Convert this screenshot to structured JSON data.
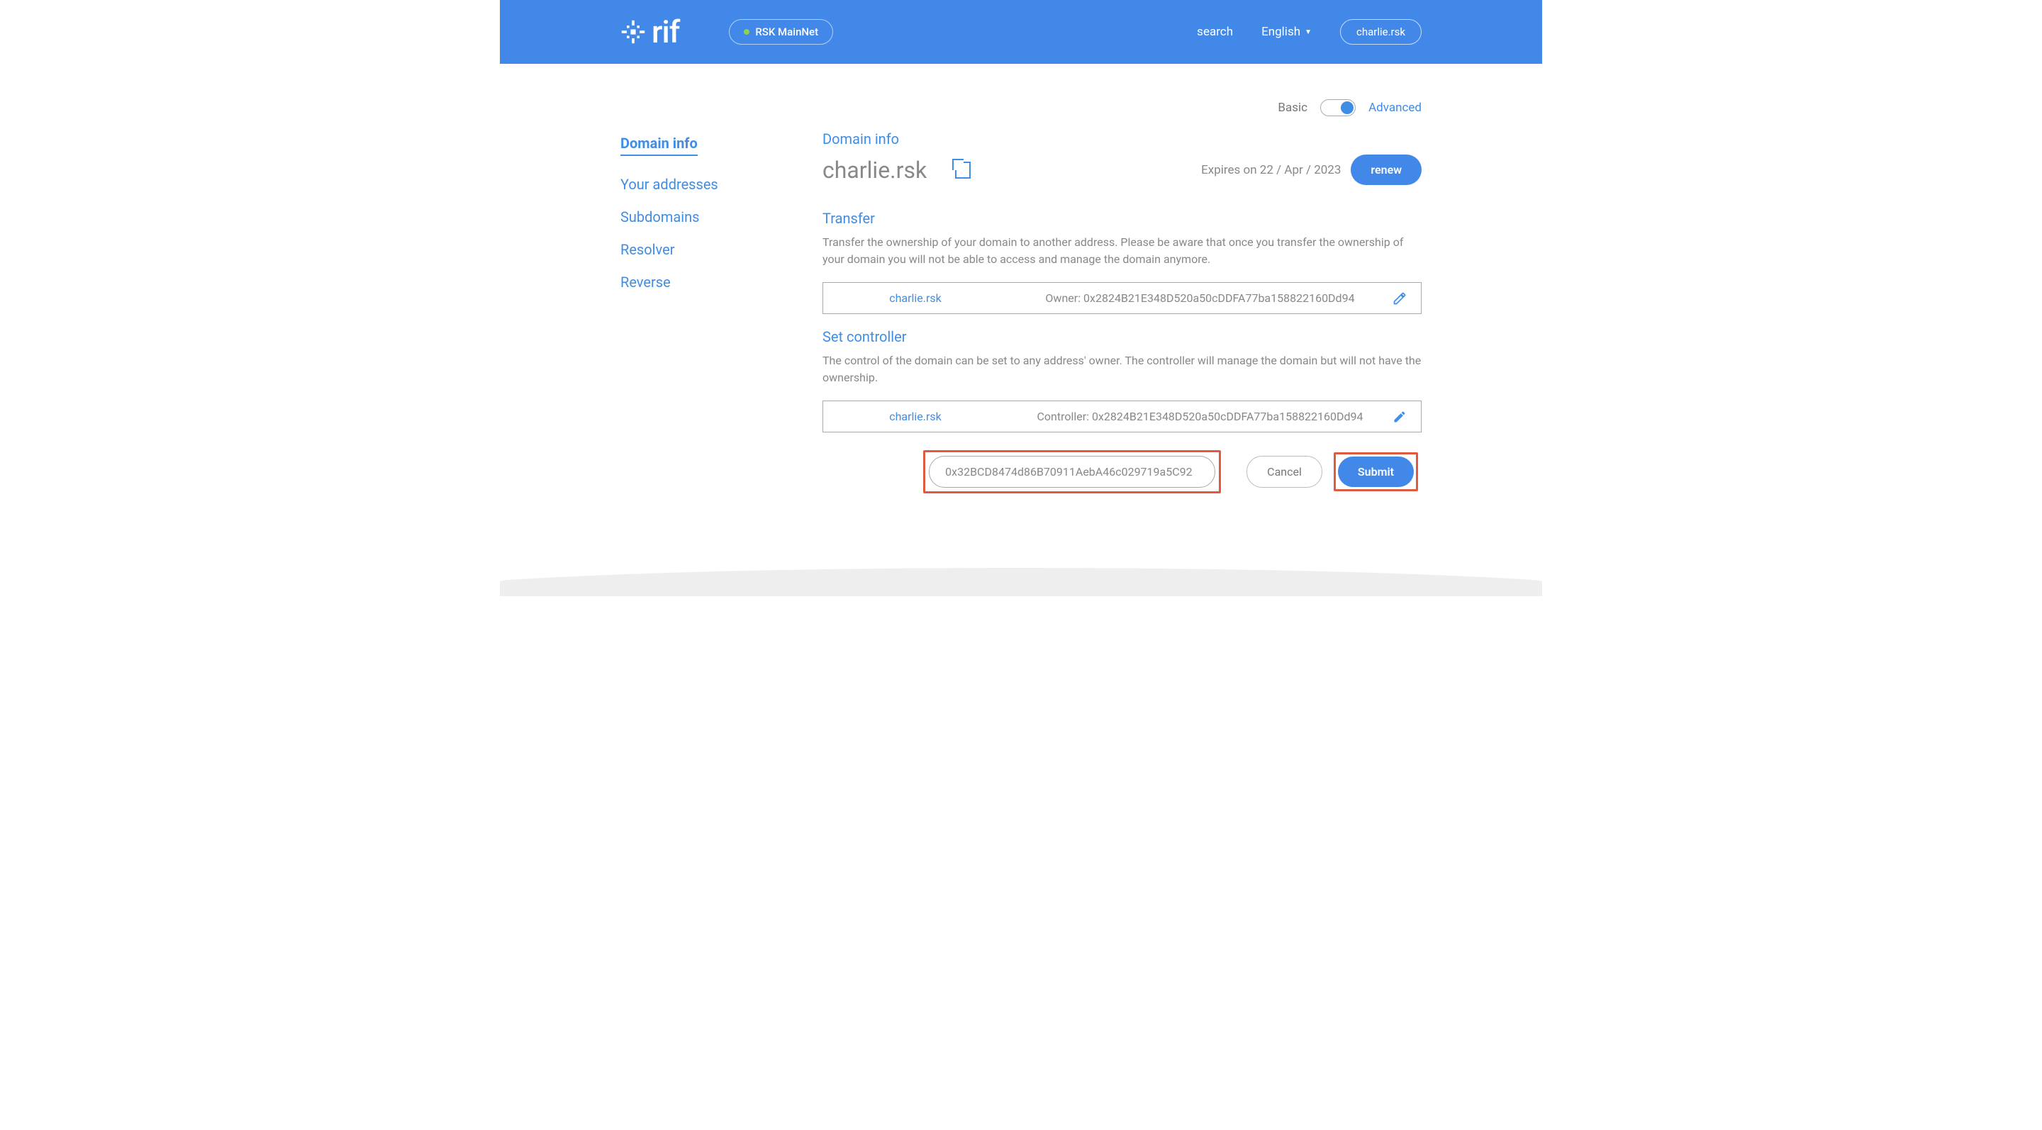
{
  "header": {
    "logo_text": "rif",
    "network": "RSK MainNet",
    "search": "search",
    "language": "English",
    "user": "charlie.rsk"
  },
  "sidebar": {
    "items": [
      {
        "label": "Domain info",
        "active": true
      },
      {
        "label": "Your addresses",
        "active": false
      },
      {
        "label": "Subdomains",
        "active": false
      },
      {
        "label": "Resolver",
        "active": false
      },
      {
        "label": "Reverse",
        "active": false
      }
    ]
  },
  "mode": {
    "basic": "Basic",
    "advanced": "Advanced"
  },
  "domain_info": {
    "title": "Domain info",
    "name": "charlie.rsk",
    "expires_label": "Expires on 22 / Apr / 2023",
    "renew_button": "renew"
  },
  "transfer": {
    "title": "Transfer",
    "description": "Transfer the ownership of your domain to another address. Please be aware that once you transfer the ownership of your domain you will not be able to access and manage the domain anymore.",
    "domain": "charlie.rsk",
    "owner_label": "Owner: 0x2824B21E348D520a50cDDFA77ba158822160Dd94"
  },
  "set_controller": {
    "title": "Set controller",
    "description": "The control of the domain can be set to any address' owner. The controller will manage the domain but will not have the ownership.",
    "domain": "charlie.rsk",
    "controller_label": "Controller: 0x2824B21E348D520a50cDDFA77ba158822160Dd94",
    "input_value": "0x32BCD8474d86B70911AebA46c029719a5C92",
    "cancel_button": "Cancel",
    "submit_button": "Submit"
  }
}
